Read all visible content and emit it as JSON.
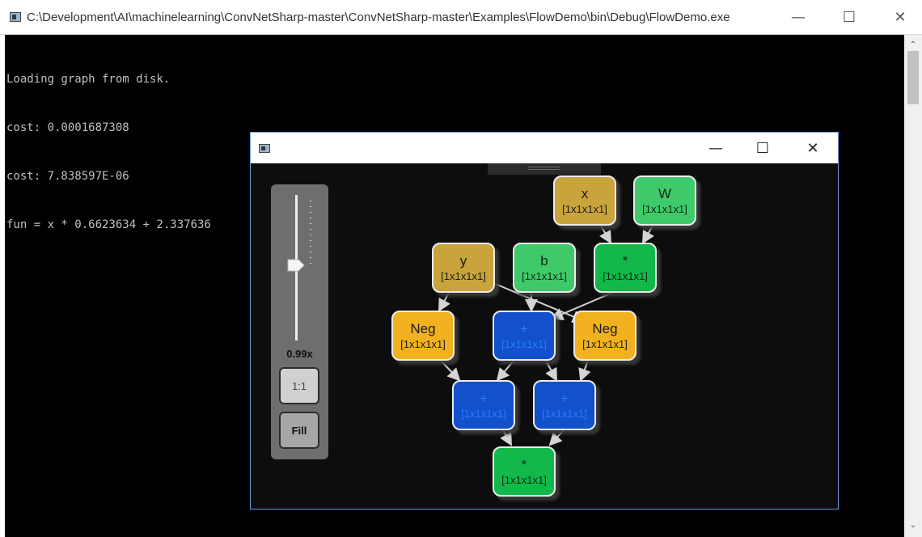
{
  "console": {
    "title": "C:\\Development\\AI\\machinelearning\\ConvNetSharp-master\\ConvNetSharp-master\\Examples\\FlowDemo\\bin\\Debug\\FlowDemo.exe",
    "lines": [
      "Loading graph from disk.",
      "cost: 0.0001687308",
      "cost: 7.838597E-06",
      "fun = x * 0.6623634 + 2.337636"
    ],
    "controls": {
      "minimize": "—",
      "maximize": "☐",
      "close": "✕"
    },
    "scroll": {
      "up": "⌃",
      "down": "⌄"
    }
  },
  "graph_window": {
    "controls": {
      "minimize": "—",
      "maximize": "☐",
      "close": "✕"
    },
    "zoom": {
      "level_label": "0.99x",
      "one_to_one_label": "1:1",
      "fill_label": "Fill"
    },
    "nodes": [
      {
        "op": "x",
        "shape": "[1x1x1x1]",
        "color": "#c9a33c"
      },
      {
        "op": "W",
        "shape": "[1x1x1x1]",
        "color": "#3fc96a"
      },
      {
        "op": "y",
        "shape": "[1x1x1x1]",
        "color": "#c9a33c"
      },
      {
        "op": "b",
        "shape": "[1x1x1x1]",
        "color": "#3fc96a"
      },
      {
        "op": "*",
        "shape": "[1x1x1x1]",
        "color": "#12b84a"
      },
      {
        "op": "Neg",
        "shape": "[1x1x1x1]",
        "color": "#f2b21f"
      },
      {
        "op": "+",
        "shape": "[1x1x1x1]",
        "color": "#1351cc"
      },
      {
        "op": "Neg",
        "shape": "[1x1x1x1]",
        "color": "#f2b21f"
      },
      {
        "op": "+",
        "shape": "[1x1x1x1]",
        "color": "#1351cc"
      },
      {
        "op": "+",
        "shape": "[1x1x1x1]",
        "color": "#1351cc"
      },
      {
        "op": "*",
        "shape": "[1x1x1x1]",
        "color": "#12b84a"
      }
    ]
  }
}
